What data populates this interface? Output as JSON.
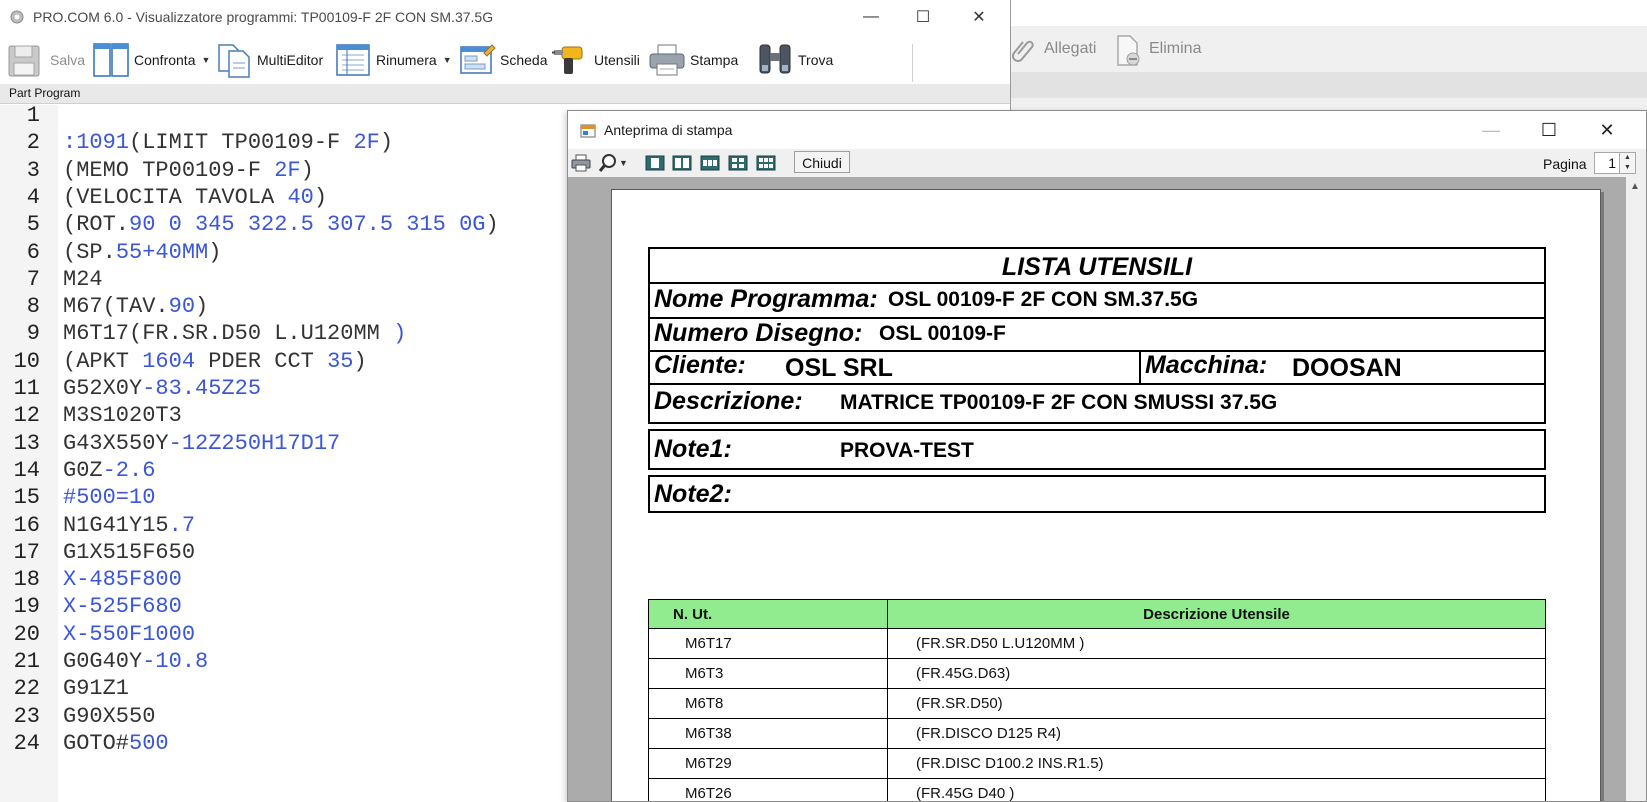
{
  "main_window": {
    "title": "PRO.COM 6.0 - Visualizzatore programmi: TP00109-F 2F CON SM.37.5G",
    "toolbar": {
      "salva": "Salva",
      "confronta": "Confronta",
      "multieditor": "MultiEditor",
      "rinumera": "Rinumera",
      "scheda": "Scheda",
      "utensili": "Utensili",
      "stampa": "Stampa",
      "trova": "Trova"
    },
    "section_label": "Part Program",
    "code_lines": [
      {
        "n": "1",
        "parts": []
      },
      {
        "n": "2",
        "parts": [
          {
            "t": ":1091",
            "b": true
          },
          {
            "t": "(LIMIT TP00109-F ",
            "b": false
          },
          {
            "t": "2F",
            "b": true
          },
          {
            "t": ")",
            "b": false
          }
        ]
      },
      {
        "n": "3",
        "parts": [
          {
            "t": "(MEMO TP00109-F ",
            "b": false
          },
          {
            "t": "2F",
            "b": true
          },
          {
            "t": ")",
            "b": false
          }
        ]
      },
      {
        "n": "4",
        "parts": [
          {
            "t": "(VELOCITA TAVOLA ",
            "b": false
          },
          {
            "t": "40",
            "b": true
          },
          {
            "t": ")",
            "b": false
          }
        ]
      },
      {
        "n": "5",
        "parts": [
          {
            "t": "(ROT.",
            "b": false
          },
          {
            "t": "90 0 345 322.5 307.5 315 0G",
            "b": true
          },
          {
            "t": ")",
            "b": false
          }
        ]
      },
      {
        "n": "6",
        "parts": [
          {
            "t": "(SP.",
            "b": false
          },
          {
            "t": "55+40MM",
            "b": true
          },
          {
            "t": ")",
            "b": false
          }
        ]
      },
      {
        "n": "7",
        "parts": [
          {
            "t": "M24",
            "b": false
          }
        ]
      },
      {
        "n": "8",
        "parts": [
          {
            "t": "M67(TAV.",
            "b": false
          },
          {
            "t": "90",
            "b": true
          },
          {
            "t": ")",
            "b": false
          }
        ]
      },
      {
        "n": "9",
        "parts": [
          {
            "t": "M6T17(FR.SR.D50 L.U120MM ",
            "b": false
          },
          {
            "t": ")",
            "b": true
          }
        ]
      },
      {
        "n": "10",
        "parts": [
          {
            "t": "(APKT ",
            "b": false
          },
          {
            "t": "1604",
            "b": true
          },
          {
            "t": " PDER CCT ",
            "b": false
          },
          {
            "t": "35",
            "b": true
          },
          {
            "t": ")",
            "b": false
          }
        ]
      },
      {
        "n": "11",
        "parts": [
          {
            "t": "G52X0Y",
            "b": false
          },
          {
            "t": "-83.45Z25",
            "b": true
          }
        ]
      },
      {
        "n": "12",
        "parts": [
          {
            "t": "M3S1020T3",
            "b": false
          }
        ]
      },
      {
        "n": "13",
        "parts": [
          {
            "t": "G43X550Y",
            "b": false
          },
          {
            "t": "-12Z250H17D17",
            "b": true
          }
        ]
      },
      {
        "n": "14",
        "parts": [
          {
            "t": "G0Z",
            "b": false
          },
          {
            "t": "-2.6",
            "b": true
          }
        ]
      },
      {
        "n": "15",
        "parts": [
          {
            "t": "#500=10",
            "b": true
          }
        ]
      },
      {
        "n": "16",
        "parts": [
          {
            "t": "N1G41Y15",
            "b": false
          },
          {
            "t": ".7",
            "b": true
          }
        ]
      },
      {
        "n": "17",
        "parts": [
          {
            "t": "G1X515F650",
            "b": false
          }
        ]
      },
      {
        "n": "18",
        "parts": [
          {
            "t": "X-485F800",
            "b": true
          }
        ]
      },
      {
        "n": "19",
        "parts": [
          {
            "t": "X-525F680",
            "b": true
          }
        ]
      },
      {
        "n": "20",
        "parts": [
          {
            "t": "X-550F1000",
            "b": true
          }
        ]
      },
      {
        "n": "21",
        "parts": [
          {
            "t": "G0G40Y",
            "b": false
          },
          {
            "t": "-10.8",
            "b": true
          }
        ]
      },
      {
        "n": "22",
        "parts": [
          {
            "t": "G91Z1",
            "b": false
          }
        ]
      },
      {
        "n": "23",
        "parts": [
          {
            "t": "G90X550",
            "b": false
          }
        ]
      },
      {
        "n": "24",
        "parts": [
          {
            "t": "GOTO#",
            "b": false
          },
          {
            "t": "500",
            "b": true
          }
        ]
      }
    ]
  },
  "background_window": {
    "allegati": "Allegati",
    "elimina": "Elimina"
  },
  "preview_window": {
    "title": "Anteprima di stampa",
    "close_button": "Chiudi",
    "page_label": "Pagina",
    "page_value": "1"
  },
  "report": {
    "heading": "LISTA UTENSILI",
    "nome_programma_label": "Nome Programma:",
    "nome_programma_value": "OSL 00109-F 2F CON SM.37.5G",
    "numero_disegno_label": "Numero Disegno:",
    "numero_disegno_value": "OSL 00109-F",
    "cliente_label": "Cliente:",
    "cliente_value": "OSL SRL",
    "macchina_label": "Macchina:",
    "macchina_value": "DOOSAN",
    "descrizione_label": "Descrizione:",
    "descrizione_value": "MATRICE TP00109-F 2F CON SMUSSI 37.5G",
    "note1_label": "Note1:",
    "note1_value": "PROVA-TEST",
    "note2_label": "Note2:",
    "note2_value": "",
    "table_headers": [
      "N. Ut.",
      "Descrizione Utensile"
    ],
    "tools": [
      {
        "ut": "M6T17",
        "desc": "(FR.SR.D50 L.U120MM )"
      },
      {
        "ut": "M6T3",
        "desc": "(FR.45G.D63)"
      },
      {
        "ut": "M6T8",
        "desc": "(FR.SR.D50)"
      },
      {
        "ut": "M6T38",
        "desc": "(FR.DISCO D125 R4)"
      },
      {
        "ut": "M6T29",
        "desc": "(FR.DISC D100.2 INS.R1.5)"
      },
      {
        "ut": "M6T26",
        "desc": "(FR.45G D40 )"
      }
    ]
  },
  "colors": {
    "code_blue": "#3b57d8",
    "header_green": "#90ec8f"
  }
}
